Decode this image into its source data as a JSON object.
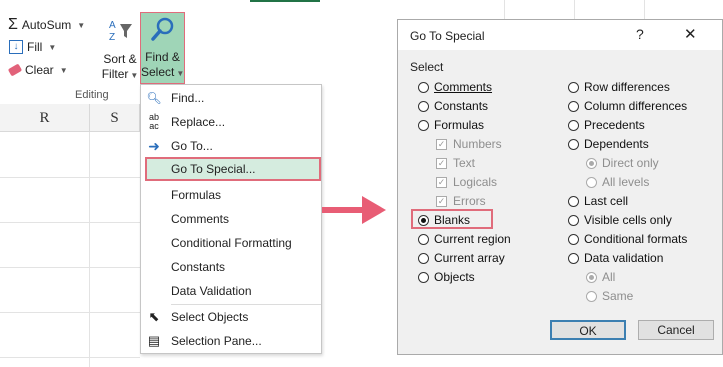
{
  "ribbon": {
    "autosum": "AutoSum",
    "fill": "Fill",
    "clear": "Clear",
    "sort_filter_line1": "Sort &",
    "sort_filter_line2": "Filter",
    "find_select_line1": "Find &",
    "find_select_line2": "Select",
    "group_label": "Editing"
  },
  "sheet": {
    "columns": [
      "R",
      "S"
    ]
  },
  "menu": {
    "items": [
      {
        "label": "Find...",
        "icon": "magnifier-icon"
      },
      {
        "label": "Replace...",
        "icon": "replace-icon"
      },
      {
        "label": "Go To...",
        "icon": "arrow-right-icon"
      },
      {
        "label": "Go To Special...",
        "icon": ""
      },
      {
        "label": "Formulas",
        "icon": ""
      },
      {
        "label": "Comments",
        "icon": ""
      },
      {
        "label": "Conditional Formatting",
        "icon": ""
      },
      {
        "label": "Constants",
        "icon": ""
      },
      {
        "label": "Data Validation",
        "icon": ""
      },
      {
        "label": "Select Objects",
        "icon": "pointer-icon"
      },
      {
        "label": "Selection Pane...",
        "icon": "selection-pane-icon"
      }
    ]
  },
  "dialog": {
    "title": "Go To Special",
    "help": "?",
    "close": "✕",
    "group_label": "Select",
    "left_options": [
      {
        "label": "Comments",
        "checked": false
      },
      {
        "label": "Constants",
        "checked": false
      },
      {
        "label": "Formulas",
        "checked": false
      }
    ],
    "formula_subs": [
      "Numbers",
      "Text",
      "Logicals",
      "Errors"
    ],
    "left_options2": [
      {
        "label": "Blanks",
        "checked": true
      },
      {
        "label": "Current region",
        "checked": false
      },
      {
        "label": "Current array",
        "checked": false
      },
      {
        "label": "Objects",
        "checked": false
      }
    ],
    "right_options": [
      {
        "label": "Row differences"
      },
      {
        "label": "Column differences"
      },
      {
        "label": "Precedents"
      },
      {
        "label": "Dependents"
      }
    ],
    "dependents_subs": [
      "Direct only",
      "All levels"
    ],
    "right_options2": [
      {
        "label": "Last cell"
      },
      {
        "label": "Visible cells only"
      },
      {
        "label": "Conditional formats"
      },
      {
        "label": "Data validation"
      }
    ],
    "validation_subs": [
      "All",
      "Same"
    ],
    "ok": "OK",
    "cancel": "Cancel"
  },
  "colors": {
    "highlight_border": "#e06c7b",
    "find_select_bg": "#9fd5b7",
    "arrow": "#e85d75"
  }
}
